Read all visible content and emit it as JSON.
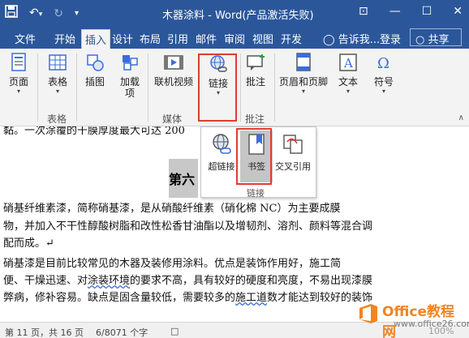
{
  "titlebar": {
    "title": "木器涂料 - Word(产品激活失败)",
    "qat": {
      "save_icon": "save-icon",
      "undo_glyph": "↶",
      "undo_arrow": "▾",
      "redo_glyph": "↻",
      "more_glyph": "▾"
    },
    "window_controls": {
      "ribbon_options": "⊡",
      "minimize": "—",
      "maximize": "☐",
      "close": "✕"
    }
  },
  "tabs": [
    "文件",
    "开始",
    "插入",
    "设计",
    "布局",
    "引用",
    "邮件",
    "审阅",
    "视图",
    "开发"
  ],
  "active_tab": "插入",
  "tell_me": "告诉我...",
  "login": "登录",
  "share": "共享",
  "ribbon": {
    "buttons": {
      "page": "页面",
      "table": "表格",
      "illustrations": "插图",
      "addins": "加载项",
      "online_video": "联机视频",
      "link": "链接",
      "comment": "批注",
      "header_footer": "页眉和页脚",
      "text": "文本",
      "symbols": "符号"
    },
    "groups": {
      "tables": "表格",
      "media": "媒体",
      "comments": "批注"
    }
  },
  "document": {
    "line0": "黏。一次涂覆的干膜厚度最大可达 200",
    "heading": "第六",
    "p1_l1": "    硝基纤维素漆，简称硝基漆，是从硝酸纤维素（硝化棉 NC）为主要成膜",
    "p1_l2": "物，并加入不干性醇酸树脂和改性松香甘油酯以及增韧剂、溶剂、颜料等混合调",
    "p1_l3": "配而成。↵",
    "p2_l1": "    硝基漆是目前比较常见的木器及装修用涂料。优点是装饰作用好，施工简",
    "p2_l2a": "便、干燥迅速、对",
    "p2_l2b": "涂装环境",
    "p2_l2c": "的要求不高，具有较好的硬度和亮度，不易出现漆膜",
    "p2_l3a": "弊病，修补容易。缺点是固含量较低，需要较多的",
    "p2_l3b": "施工道",
    "p2_l3c": "数才能达到较好的装饰"
  },
  "dropdown": {
    "hyperlink": "超链接",
    "bookmark": "书签",
    "crossref": "交叉引用",
    "group": "链接"
  },
  "status": {
    "page": "第 11 页，共 16 页",
    "words": "6/8071 个字",
    "zoom": "100%"
  },
  "watermark": {
    "title": "Office教程网",
    "url": "www.office26.com"
  },
  "colors": {
    "title_bar": "#2b579a",
    "ribbon": "#f3f3f3",
    "highlight": "#e03c31",
    "watermark_orange": "#f08522"
  }
}
